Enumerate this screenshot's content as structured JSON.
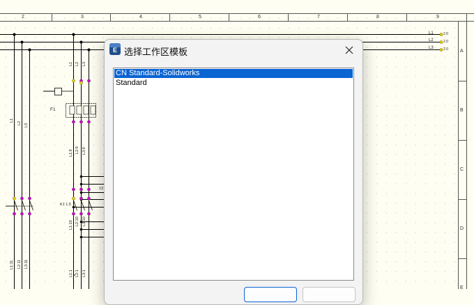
{
  "drawing": {
    "columns": [
      "2",
      "3",
      "4",
      "5",
      "6",
      "7",
      "8",
      "9"
    ],
    "rows": [
      "A",
      "B",
      "C",
      "D",
      "E"
    ],
    "terminals": [
      "L1",
      "L2",
      "L3"
    ],
    "terminal_values": [
      "2.0",
      "2.0",
      "2.0"
    ],
    "component_f1": "F1",
    "component_k": "K1\n1.5",
    "wire_labels": [
      "L1",
      "L2",
      "L3",
      "L1:1",
      "L2:1",
      "L3:1",
      "L1:2",
      "L2:2",
      "L3:2",
      "L1:3",
      "L2:3",
      "L3:3",
      "L1:9",
      "L2:9",
      "L3:9",
      "L1:10",
      "L2:10",
      "L3:10",
      "L1:11",
      "L2:11",
      "L3:11",
      "L1:1",
      "L2:1",
      "L3:1",
      "13"
    ],
    "colors": {
      "background": "#fffef2",
      "wire": "#000000",
      "pin_yellow": "#e8d000",
      "pin_magenta": "#cc00cc",
      "grid": "#9a9a9a"
    }
  },
  "dialog": {
    "title": "选择工作区模板",
    "icon_letters": "E",
    "close_icon": "close-icon",
    "templates": [
      {
        "label": "CN Standard-Solidworks",
        "selected": true
      },
      {
        "label": "Standard",
        "selected": false
      }
    ],
    "ok_label": "",
    "cancel_label": "",
    "accent": "#0a64d2"
  }
}
